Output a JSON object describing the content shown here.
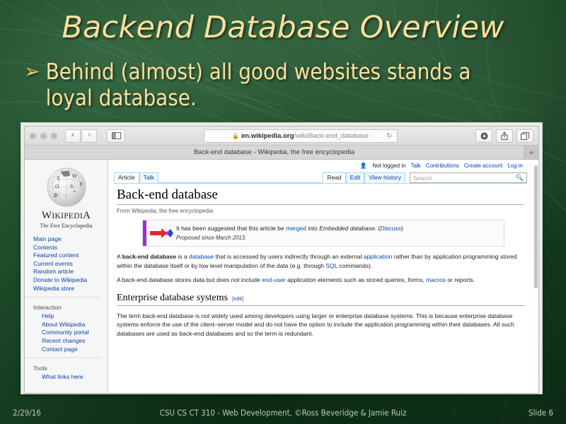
{
  "slide": {
    "title": "Backend Database Overview",
    "bullet_marker": "➢",
    "bullet_text": "Behind (almost) all good websites stands a loyal database.",
    "footer": {
      "date": "2/29/16",
      "center": "CSU CS CT 310 - Web Development, ©Ross Beveridge & Jamie Ruiz",
      "slide_number": "Slide 6"
    },
    "colors": {
      "title_gold": "#fcdf9d",
      "bullet_gold": "#f0c96a",
      "background_green": "#1b4526",
      "footer_text": "#b9cbb4"
    }
  },
  "browser": {
    "toolbar": {
      "back_glyph": "‹",
      "forward_glyph": "›",
      "sidebar_icon_name": "sidebar-icon",
      "url_lock": "ὑ2",
      "url_domain": "en.wikipedia.org",
      "url_path": "/wiki/Back-end_database",
      "reload_glyph": "↻",
      "download_glyph": "↓",
      "share_glyph": "⇧",
      "tabs_glyph": "⧉"
    },
    "tab": {
      "title": "Back-end database - Wikipedia, the free encyclopedia",
      "new_tab_glyph": "+"
    }
  },
  "wikipedia": {
    "logo": {
      "wordmark_w": "W",
      "wordmark_rest": "IKIPEDI",
      "wordmark_a": "A",
      "tagline": "The Free Encyclopedia"
    },
    "personal_tools": {
      "status": "Not logged in",
      "links": [
        "Talk",
        "Contributions",
        "Create account",
        "Log in"
      ]
    },
    "namespace_tabs": [
      {
        "label": "Article",
        "selected": true
      },
      {
        "label": "Talk",
        "selected": false
      }
    ],
    "view_tabs": [
      {
        "label": "Read",
        "selected": true
      },
      {
        "label": "Edit",
        "selected": false
      },
      {
        "label": "View history",
        "selected": false
      }
    ],
    "search": {
      "placeholder": "Search",
      "icon": "search-icon"
    },
    "sidebar": {
      "main_links": [
        "Main page",
        "Contents",
        "Featured content",
        "Current events",
        "Random article",
        "Donate to Wikipedia",
        "Wikipedia store"
      ],
      "interaction_heading": "Interaction",
      "interaction_links": [
        "Help",
        "About Wikipedia",
        "Community portal",
        "Recent changes",
        "Contact page"
      ],
      "tools_heading": "Tools",
      "tools_links": [
        "What links here"
      ]
    },
    "article": {
      "title": "Back-end database",
      "subtitle": "From Wikipedia, the free encyclopedia",
      "merge_notice": {
        "text_before": "It has been suggested that this article be ",
        "link_merged": "merged",
        "text_into": " into ",
        "target_italic": "Embedded database.",
        "discuss_open": " (",
        "link_discuss": "Discuss",
        "discuss_close": ")",
        "proposed": "Proposed since March 2013.",
        "bar_color": "#9932cc"
      },
      "paragraph1": {
        "p1": "A ",
        "bold": "back-end database",
        "p2": " is a ",
        "link1": "database",
        "p3": " that is accessed by users indirectly through an external ",
        "link2": "application",
        "p4": " rather than by application programming stored within the database itself or by low level manipulation of the data (e.g. through ",
        "link3": "SQL",
        "p5": " commands)."
      },
      "paragraph2": {
        "p1": "A back-end database stores data but does not include ",
        "link1": "end-user",
        "p2": " application elements such as stored queries, forms, ",
        "link2": "macros",
        "p3": " or reports."
      },
      "section": {
        "heading": "Enterprise database systems",
        "edit_open": "[",
        "edit_label": "edit",
        "edit_close": "]",
        "body": "The term back-end database is not widely used among developers using larger or enterprise database systems. This is because enterprise database systems enforce the use of the client–server model and do not have the option to include the application programming within their databases. All such databases are used as back-end databases and so the term is redundant."
      }
    }
  }
}
